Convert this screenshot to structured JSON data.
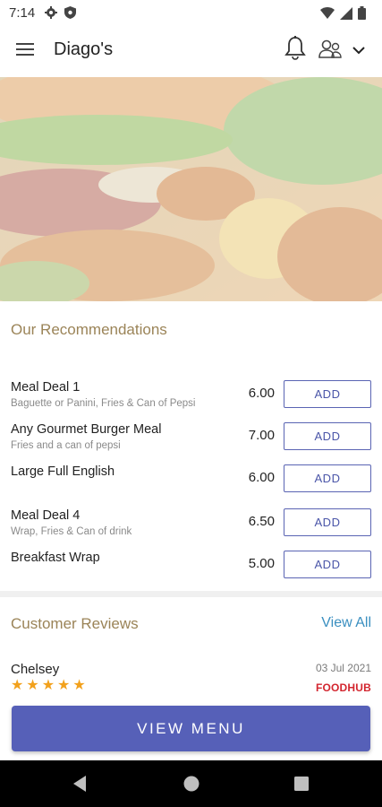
{
  "status_bar": {
    "time": "7:14",
    "icons": [
      "settings-icon",
      "shield-icon",
      "wifi-icon",
      "signal-icon",
      "battery-icon"
    ]
  },
  "app_bar": {
    "title": "Diago's",
    "icons": [
      "hamburger-menu-icon",
      "bell-icon",
      "user-icon",
      "chevron-down-icon"
    ]
  },
  "recommendations": {
    "title": "Our Recommendations",
    "items": [
      {
        "name": "Meal Deal 1",
        "description": "Baguette or Panini, Fries & Can of Pepsi",
        "price": "6.00",
        "button": "ADD"
      },
      {
        "name": "Any Gourmet Burger Meal",
        "description": "Fries and a can of pepsi",
        "price": "7.00",
        "button": "ADD"
      },
      {
        "name": "Large Full English",
        "description": "",
        "price": "6.00",
        "button": "ADD"
      },
      {
        "name": "Meal Deal 4",
        "description": "Wrap, Fries & Can of drink",
        "price": "6.50",
        "button": "ADD"
      },
      {
        "name": "Breakfast Wrap",
        "description": "",
        "price": "5.00",
        "button": "ADD"
      }
    ]
  },
  "reviews": {
    "title": "Customer Reviews",
    "view_all": "View All",
    "items": [
      {
        "reviewer": "Chelsey",
        "date": "03 Jul 2021",
        "rating": 5,
        "source": "FOODHUB"
      }
    ]
  },
  "cta": {
    "label": "VIEW MENU"
  },
  "colors": {
    "accent": "#5660b8",
    "section_title": "#9b8458",
    "star": "#f2a11c",
    "link": "#3a8fc0",
    "source_logo": "#d3262f"
  }
}
